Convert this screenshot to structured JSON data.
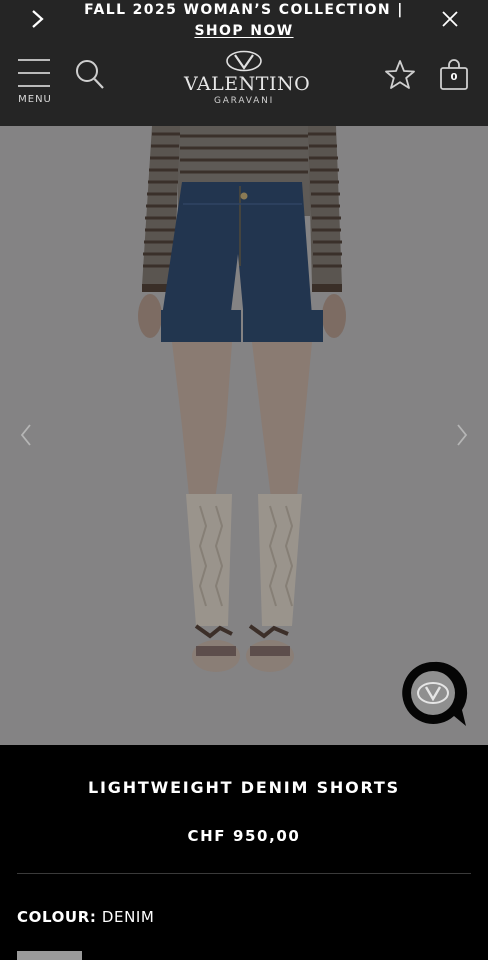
{
  "announcement": {
    "text": "FALL 2025 WOMAN’S COLLECTION | ",
    "link": "SHOP NOW",
    "prev_icon": "chevron-right-icon",
    "close_icon": "close-icon"
  },
  "header": {
    "menu_label": "MENU",
    "brand": "VALENTINO",
    "brand_sub": "GARAVANI",
    "bag_count": "0"
  },
  "product": {
    "title": "LIGHTWEIGHT DENIM SHORTS",
    "price": "CHF 950,00",
    "colour_label": "COLOUR:",
    "colour_value": " DENIM"
  },
  "colors": {
    "header_bg": "#252525",
    "page_bg": "#000000",
    "overlay": "#848384"
  }
}
